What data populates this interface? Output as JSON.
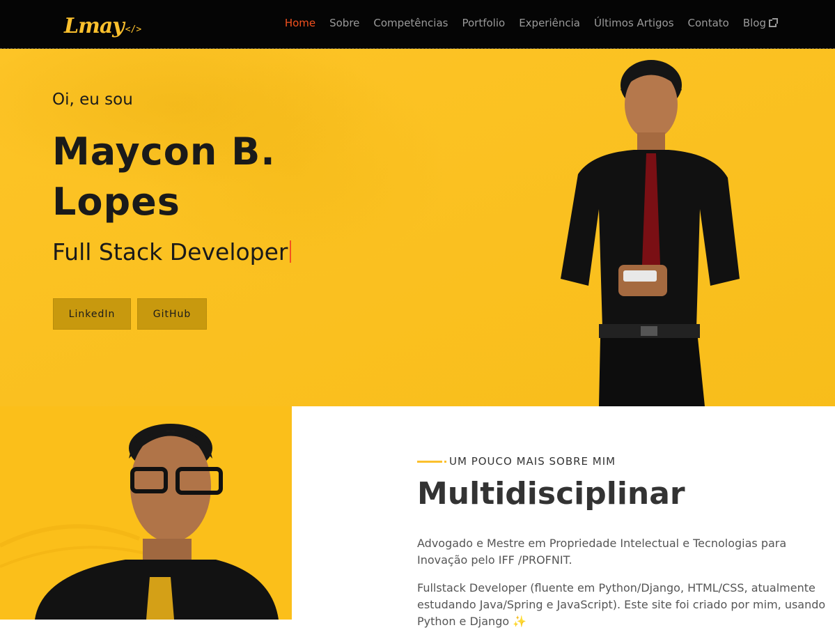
{
  "nav": {
    "logo_text": "Lmay",
    "logo_code": "</>",
    "items": [
      {
        "label": "Home",
        "active": true
      },
      {
        "label": "Sobre"
      },
      {
        "label": "Competências"
      },
      {
        "label": "Portfolio"
      },
      {
        "label": "Experiência"
      },
      {
        "label": "Últimos Artigos"
      },
      {
        "label": "Contato"
      },
      {
        "label": "Blog",
        "icon": "external-link-icon"
      }
    ]
  },
  "hero": {
    "greeting": "Oi, eu sou",
    "name": "Maycon B. Lopes",
    "role": "Full Stack Developer",
    "buttons": {
      "linkedin": "LinkedIn",
      "github": "GitHub"
    }
  },
  "about": {
    "subtitle": "UM POUCO MAIS SOBRE MIM",
    "title": "Multidisciplinar",
    "paragraph1": "Advogado e Mestre em Propriedade Intelectual e Tecnologias para Inovação pelo IFF /PROFNIT.",
    "paragraph2": "Fullstack Developer (fluente em Python/Django, HTML/CSS, atualmente estudando Java/Spring e JavaScript). Este site foi criado por mim, usando Python e Django ✨"
  },
  "colors": {
    "accent": "#fdc11b",
    "active": "#f4511e",
    "nav_bg": "#050505"
  }
}
